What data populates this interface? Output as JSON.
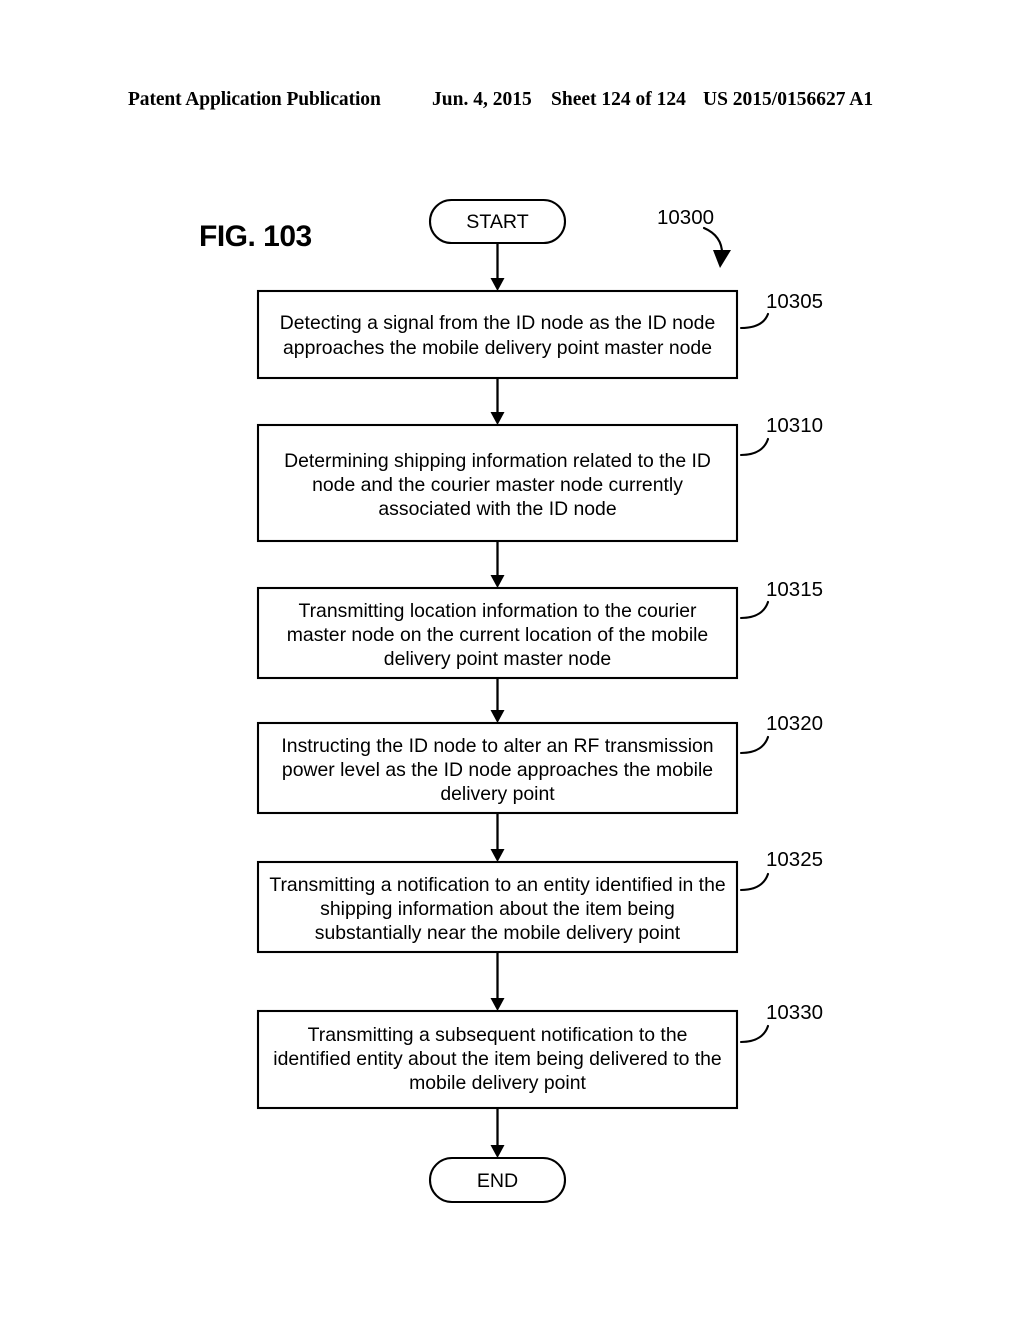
{
  "header": {
    "title": "Patent Application Publication",
    "date": "Jun. 4, 2015",
    "sheet": "Sheet 124 of 124",
    "publication_number": "US 2015/0156627 A1"
  },
  "figure": {
    "label": "FIG. 103",
    "diagram_reference": "10300"
  },
  "flowchart": {
    "start_label": "START",
    "end_label": "END",
    "steps": [
      {
        "ref": "10305",
        "lines": [
          "Detecting a signal from the ID node as the ID node",
          "approaches the mobile delivery point master node"
        ]
      },
      {
        "ref": "10310",
        "lines": [
          "Determining shipping information related to the ID",
          "node and the courier master node currently",
          "associated with the ID node"
        ]
      },
      {
        "ref": "10315",
        "lines": [
          "Transmitting location information to the courier",
          "master node on the current location of the mobile",
          "delivery point master node"
        ]
      },
      {
        "ref": "10320",
        "lines": [
          "Instructing the ID node to alter an RF transmission",
          "power level as the ID node approaches the mobile",
          "delivery point"
        ]
      },
      {
        "ref": "10325",
        "lines": [
          "Transmitting a notification to an entity identified in the",
          "shipping information about the item being",
          "substantially near the mobile delivery point"
        ]
      },
      {
        "ref": "10330",
        "lines": [
          "Transmitting a subsequent notification to the",
          "identified entity about the item being delivered to the",
          "mobile delivery point"
        ]
      }
    ]
  },
  "colors": {
    "ink": "#000000",
    "paper": "#ffffff"
  }
}
